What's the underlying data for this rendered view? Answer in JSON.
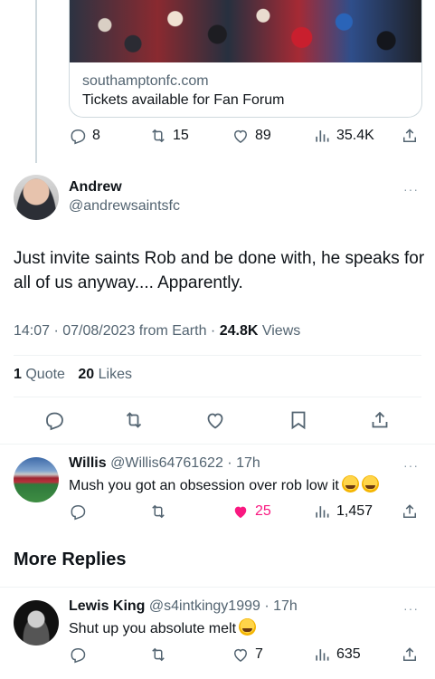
{
  "link_card": {
    "domain": "southamptonfc.com",
    "title": "Tickets available for Fan Forum"
  },
  "parent_actions": {
    "replies": "8",
    "reposts": "15",
    "likes": "89",
    "views": "35.4K"
  },
  "main_tweet": {
    "name": "Andrew",
    "handle": "@andrewsaintsfc",
    "text": "Just invite saints Rob and be done with, he speaks for all of us anyway.... Apparently.",
    "time": "14:07 · 07/08/2023 from Earth",
    "separator": "·",
    "views_count": "24.8K",
    "views_label": "Views",
    "quotes_count": "1",
    "quotes_label": "Quote",
    "likes_count": "20",
    "likes_label": "Likes"
  },
  "replies": [
    {
      "name": "Willis",
      "handle": "@Willis64761622",
      "time": "· 17h",
      "text": "Mush you got an obsession over rob low it",
      "replies": "",
      "reposts": "",
      "likes": "25",
      "views": "1,457"
    }
  ],
  "more_replies_title": "More Replies",
  "more_replies": [
    {
      "name": "Lewis King",
      "handle": "@s4intkingy1999",
      "time": "· 17h",
      "text": "Shut up you absolute melt",
      "likes": "7",
      "views": "635"
    }
  ],
  "more_label": "···",
  "colors": {
    "text_primary": "#0f1419",
    "text_secondary": "#536471",
    "liked_pink": "#f91880",
    "divider": "#eff3f4"
  }
}
